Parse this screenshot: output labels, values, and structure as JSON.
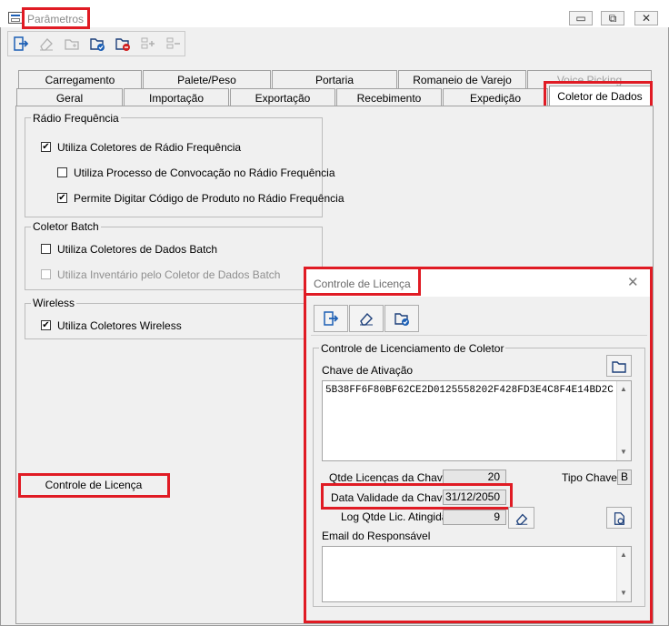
{
  "window": {
    "title": "Parâmetros",
    "minimize_glyph": "▭",
    "maximize_glyph": "⧉",
    "close_glyph": "✕"
  },
  "toolbar": {
    "icons": [
      "exit-icon",
      "eraser-icon",
      "new-folder-icon",
      "save-folder-icon",
      "delete-folder-icon",
      "add-item-icon",
      "remove-item-icon"
    ]
  },
  "tabs": {
    "row1": [
      "Carregamento",
      "Palete/Peso",
      "Portaria",
      "Romaneio de Varejo",
      "Voice Picking"
    ],
    "row2": [
      "Geral",
      "Importação",
      "Exportação",
      "Recebimento",
      "Expedição",
      "Coletor de Dados"
    ],
    "active": "Coletor de Dados"
  },
  "radio_frequencia": {
    "title": "Rádio Frequência",
    "items": [
      {
        "label": "Utiliza Coletores de Rádio Frequência",
        "checked": true
      },
      {
        "label": "Utiliza Processo de Convocação no Rádio Frequência",
        "checked": false
      },
      {
        "label": "Permite Digitar Código de Produto no Rádio Frequência",
        "checked": true
      }
    ]
  },
  "coletor_batch": {
    "title": "Coletor Batch",
    "items": [
      {
        "label": "Utiliza Coletores de Dados Batch",
        "checked": false
      },
      {
        "label": "Utiliza Inventário pelo Coletor de Dados Batch",
        "checked": false,
        "disabled": true
      }
    ]
  },
  "wireless": {
    "title": "Wireless",
    "items": [
      {
        "label": "Utiliza Coletores Wireless",
        "checked": true
      }
    ]
  },
  "controle_licenca_button": "Controle de Licença",
  "dialog": {
    "title": "Controle de Licença",
    "close_glyph": "✕",
    "toolbar_icons": [
      "exit-icon",
      "eraser-icon",
      "save-folder-icon"
    ],
    "group_title": "Controle de Licenciamento de Coletor",
    "chave_label": "Chave de Ativação",
    "chave_value": "5B38FF6F80BF62CE2D0125558202F428FD3E4C8F4E14BD2C",
    "qtde_label": "Qtde Licenças da Chave",
    "qtde_value": "20",
    "tipo_label": "Tipo Chave",
    "tipo_value": "B",
    "data_label": "Data Validade da Chave",
    "data_value": "31/12/2050",
    "log_label": "Log Qtde Lic. Atingida",
    "log_value": "9",
    "email_label": "Email do Responsável",
    "email_value": ""
  },
  "colors": {
    "highlight": "#e01b24",
    "window_bg": "#f0f0f0",
    "check": "#000000"
  }
}
